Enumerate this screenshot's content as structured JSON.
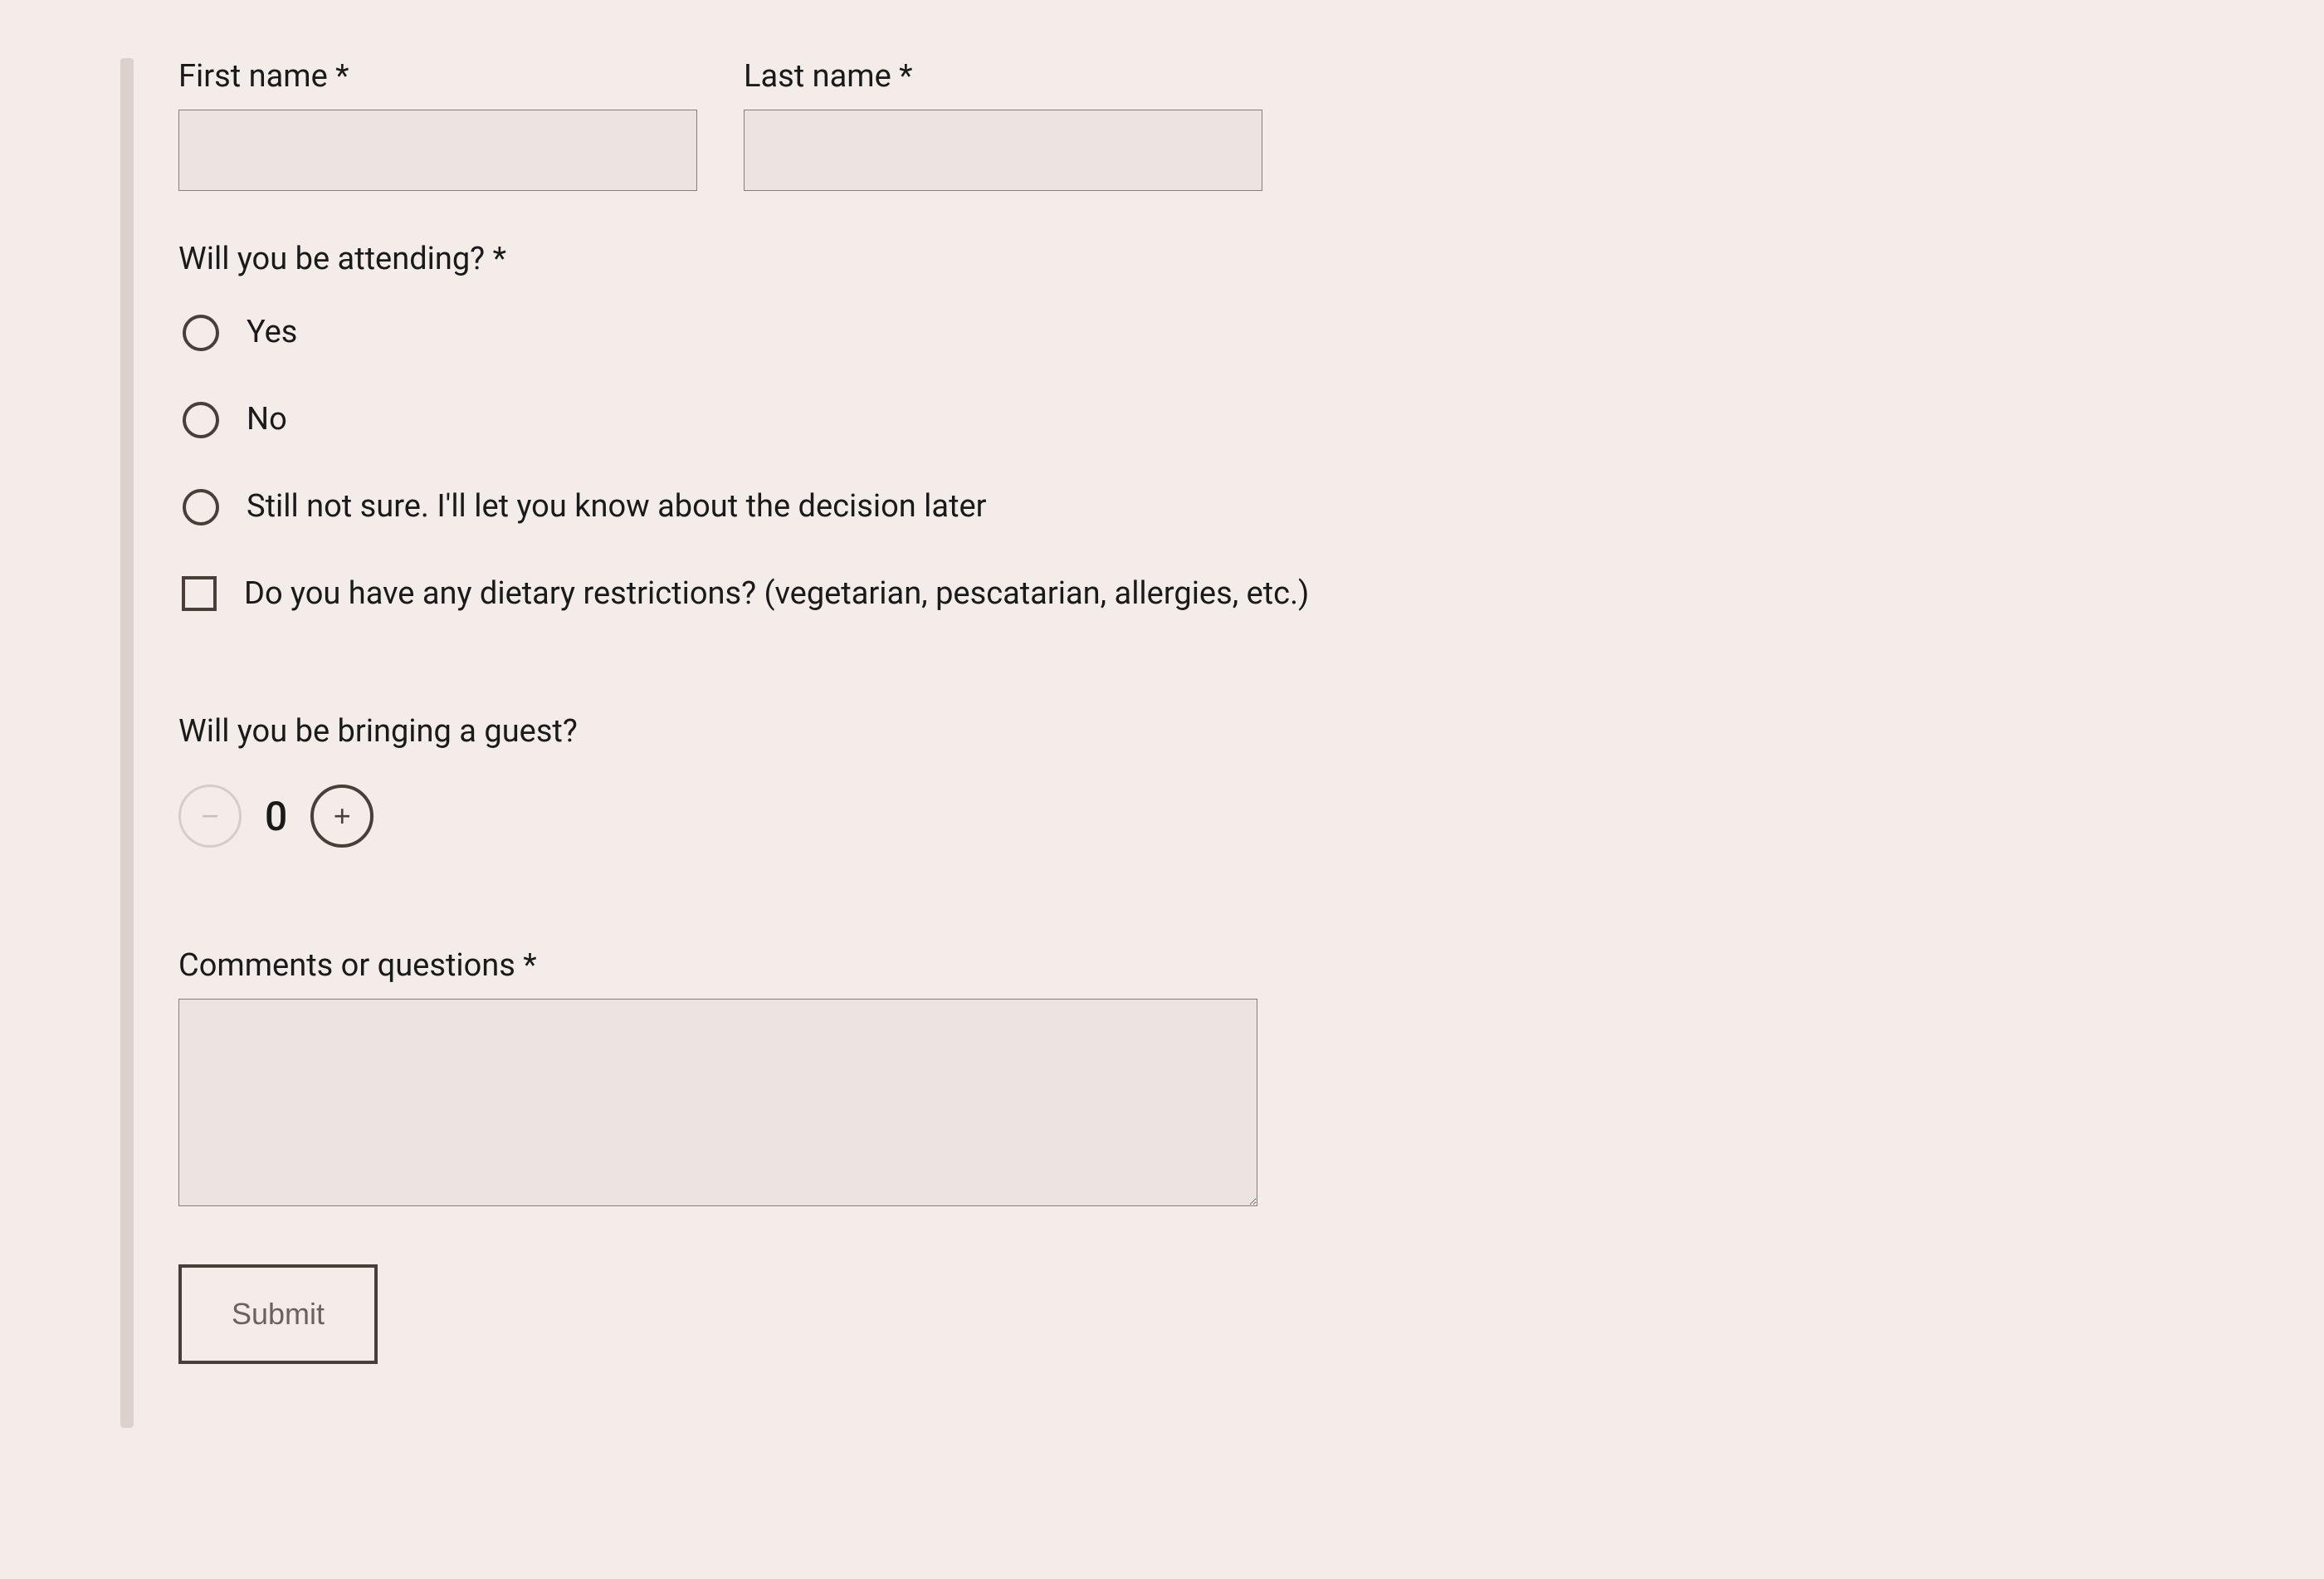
{
  "fields": {
    "first_name_label": "First name *",
    "last_name_label": "Last name *",
    "first_name_value": "",
    "last_name_value": ""
  },
  "attending": {
    "label": "Will you be attending? *",
    "options": {
      "yes": "Yes",
      "no": "No",
      "unsure": "Still not sure. I'll let you know about the decision later"
    }
  },
  "dietary": {
    "label": "Do you have any dietary restrictions? (vegetarian, pescatarian, allergies, etc.)"
  },
  "guest": {
    "label": "Will you be bringing a guest?",
    "value": "0",
    "minus": "−",
    "plus": "+"
  },
  "comments": {
    "label": "Comments or questions *",
    "value": ""
  },
  "submit_label": "Submit"
}
